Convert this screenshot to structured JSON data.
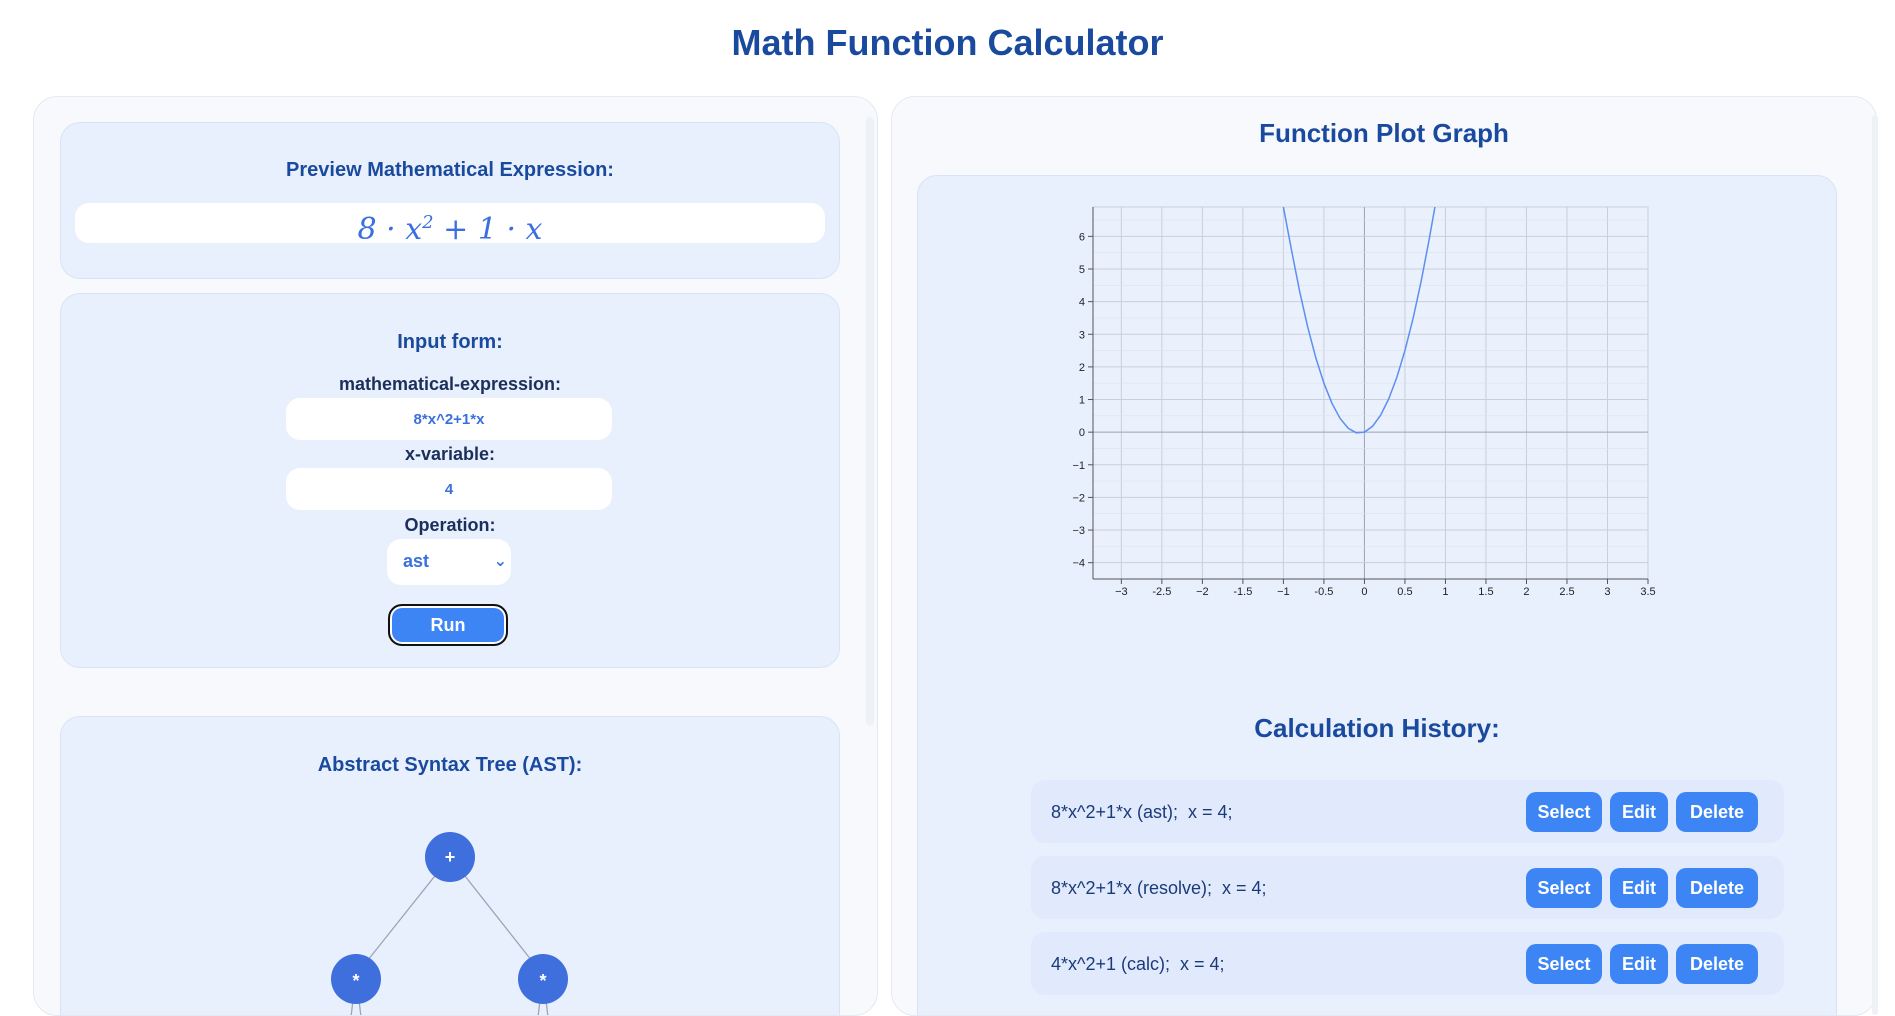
{
  "app": {
    "title": "Math Function Calculator"
  },
  "preview": {
    "title": "Preview Mathematical Expression:",
    "expression": "8 · x² + 1 · x"
  },
  "input_form": {
    "title": "Input form:",
    "expression_label": "mathematical-expression:",
    "expression_value": "8*x^2+1*x",
    "x_label": "x-variable:",
    "x_value": "4",
    "operation_label": "Operation:",
    "operation_value": "ast",
    "run_label": "Run"
  },
  "ast": {
    "title": "Abstract Syntax Tree (AST):",
    "nodes": [
      "+",
      "*",
      "*"
    ]
  },
  "graph": {
    "title": "Function Plot Graph"
  },
  "chart_data": {
    "type": "line",
    "title": "",
    "xlabel": "",
    "ylabel": "",
    "xlim": [
      -3.35,
      3.5
    ],
    "ylim": [
      -4.5,
      6.9
    ],
    "x_ticks": [
      "−3",
      "-2.5",
      "−2",
      "-1.5",
      "−1",
      "-0.5",
      "0",
      "0.5",
      "1",
      "1.5",
      "2",
      "2.5",
      "3",
      "3.5"
    ],
    "y_ticks": [
      "6",
      "5",
      "4",
      "3",
      "2",
      "1",
      "0",
      "−1",
      "−2",
      "−3",
      "−4"
    ],
    "grid": true,
    "series": [
      {
        "function": "8*x^2+1*x",
        "color": "#5b8ff0",
        "x": [
          -1.0,
          -0.9,
          -0.8,
          -0.7,
          -0.6,
          -0.5,
          -0.4,
          -0.3,
          -0.2,
          -0.1,
          0.0,
          0.1,
          0.2,
          0.3,
          0.4,
          0.5,
          0.6,
          0.7,
          0.8,
          0.87
        ],
        "y": [
          7.0,
          5.58,
          4.32,
          3.22,
          2.28,
          1.5,
          0.88,
          0.42,
          0.12,
          -0.02,
          0.0,
          0.18,
          0.52,
          1.02,
          1.68,
          2.5,
          3.48,
          4.62,
          5.92,
          6.93
        ]
      }
    ]
  },
  "history": {
    "title": "Calculation History:",
    "items": [
      {
        "text": "8*x^2+1*x (ast);  x = 4;"
      },
      {
        "text": "8*x^2+1*x (resolve);  x = 4;"
      },
      {
        "text": "4*x^2+1 (calc);  x = 4;"
      }
    ],
    "select_label": "Select",
    "edit_label": "Edit",
    "delete_label": "Delete"
  }
}
